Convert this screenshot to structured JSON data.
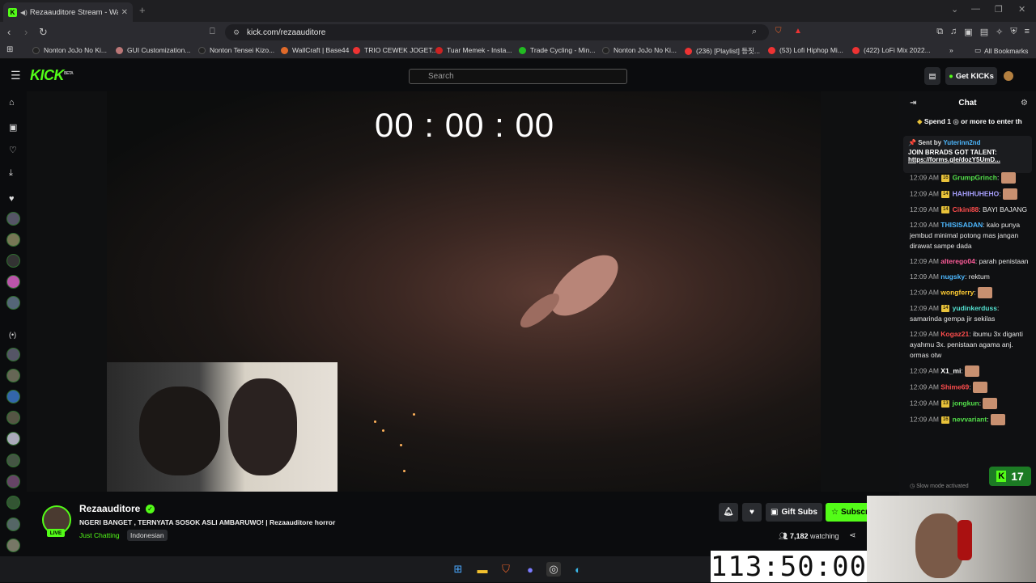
{
  "browser": {
    "tab_title": "Rezaauditore Stream - Watch",
    "url": "kick.com/rezaauditore",
    "bookmarks": [
      {
        "label": "Nonton JoJo No Ki...",
        "color": "#222"
      },
      {
        "label": "GUI Customization...",
        "color": "#b77"
      },
      {
        "label": "Nonton Tensei Kizo...",
        "color": "#222"
      },
      {
        "label": "WallCraft | Base44",
        "color": "#e06a2a"
      },
      {
        "label": "TRIO CEWEK JOGET...",
        "color": "#e33"
      },
      {
        "label": "Tuar Memek - Insta...",
        "color": "#c22"
      },
      {
        "label": "Trade Cycling - Min...",
        "color": "#2b2"
      },
      {
        "label": "Nonton JoJo No Ki...",
        "color": "#222"
      },
      {
        "label": "(236) [Playlist] 등짓...",
        "color": "#e33"
      },
      {
        "label": "(53) Lofi Hiphop Mi...",
        "color": "#e33"
      },
      {
        "label": "(422) LoFi Mix 2022...",
        "color": "#e33"
      }
    ],
    "all_bookmarks": "All Bookmarks"
  },
  "header": {
    "logo": "KICK",
    "logo_tag": "BETA",
    "search_placeholder": "Search",
    "get_kicks": "Get KICKs"
  },
  "video": {
    "timer": "00 : 00 : 00"
  },
  "chat": {
    "title": "Chat",
    "spend_text": "Spend 1 ◎ or more to enter th",
    "pinned_sent_by": "Sent by",
    "pinned_user": "Yuterinn2nd",
    "pinned_message": "JOIN BRRADS GOT TALENT:",
    "pinned_link": "https://forms.gle/dozY5UmD...",
    "messages": [
      {
        "time": "12:09 AM",
        "badge": "16",
        "user": "GrumpGrinch",
        "color": "#53e04a",
        "text": "",
        "emote": true
      },
      {
        "time": "12:09 AM",
        "badge": "14",
        "user": "HAHIHUHEHO",
        "color": "#a8a0ff",
        "text": "",
        "emote": true
      },
      {
        "time": "12:09 AM",
        "badge": "14",
        "user": "Cikini88",
        "color": "#ff4d4d",
        "text": "BAYI BAJANG",
        "emote": false
      },
      {
        "time": "12:09 AM",
        "badge": "",
        "user": "THISISADAN",
        "color": "#4db8ff",
        "text": "kalo punya jembud minimal potong mas jangan dirawat sampe dada",
        "emote": false
      },
      {
        "time": "12:09 AM",
        "badge": "",
        "user": "alterego04",
        "color": "#ff5c9a",
        "text": "parah penistaan",
        "emote": false
      },
      {
        "time": "12:09 AM",
        "badge": "",
        "user": "nugsky",
        "color": "#4db8ff",
        "text": "rektum",
        "emote": false
      },
      {
        "time": "12:09 AM",
        "badge": "",
        "user": "wongferry",
        "color": "#ffcc33",
        "text": "",
        "emote": true
      },
      {
        "time": "12:09 AM",
        "badge": "14",
        "user": "yudinkerduss",
        "color": "#53e0d0",
        "text": "samarinda gempa jir sekilas",
        "emote": false
      },
      {
        "time": "12:09 AM",
        "badge": "",
        "user": "Kogaz21",
        "color": "#ff4d4d",
        "text": "ibumu 3x diganti ayahmu 3x. penistaan agama anj. ormas otw",
        "emote": false
      },
      {
        "time": "12:09 AM",
        "badge": "",
        "user": "X1_mi",
        "color": "#ffffff",
        "text": "",
        "emote": true
      },
      {
        "time": "12:09 AM",
        "badge": "",
        "user": "Shime69",
        "color": "#ff4d4d",
        "text": "",
        "emote": true
      },
      {
        "time": "12:09 AM",
        "badge": "13",
        "user": "jongkun",
        "color": "#53e04a",
        "text": "",
        "emote": true
      },
      {
        "time": "12:09 AM",
        "badge": "16",
        "user": "nevvariant",
        "color": "#53e04a",
        "text": "",
        "emote": true
      }
    ],
    "slow_mode": "Slow mode activated",
    "kicks_count": "17"
  },
  "stream_info": {
    "channel": "Rezaauditore",
    "live": "LIVE",
    "title": "NGERI BANGET , TERNYATA SOSOK ASLI AMBARUWO! | Rezaauditore horror",
    "category": "Just Chatting",
    "language": "Indonesian",
    "gift_subs": "Gift Subs",
    "subscribe": "Subscribe",
    "viewers": "7,182",
    "watching": "watching"
  },
  "overlay": {
    "clock": "113:50:00"
  }
}
